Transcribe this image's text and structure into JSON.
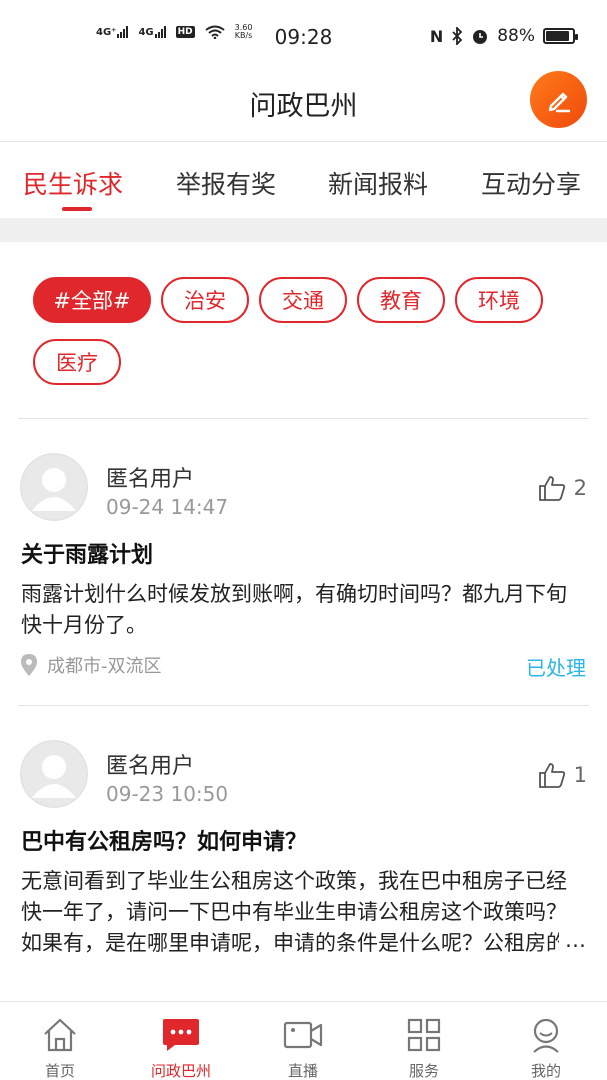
{
  "status_bar": {
    "net1": "4G⁺",
    "net2": "4G",
    "hd": "HD",
    "speed_value": "3.60",
    "speed_unit": "KB/s",
    "time": "09:28",
    "battery": "88%",
    "battery_level": 0.88
  },
  "header": {
    "title": "问政巴州",
    "compose_icon": "pencil-icon"
  },
  "tabs": [
    {
      "label": "民生诉求",
      "active": true
    },
    {
      "label": "举报有奖",
      "active": false
    },
    {
      "label": "新闻报料",
      "active": false
    },
    {
      "label": "互动分享",
      "active": false
    }
  ],
  "tags": [
    {
      "label": "#全部#",
      "active": true
    },
    {
      "label": "治安",
      "active": false
    },
    {
      "label": "交通",
      "active": false
    },
    {
      "label": "教育",
      "active": false
    },
    {
      "label": "环境",
      "active": false
    },
    {
      "label": "医疗",
      "active": false
    }
  ],
  "posts": [
    {
      "user": "匿名用户",
      "time": "09-24 14:47",
      "likes": "2",
      "title": "关于雨露计划",
      "body": "雨露计划什么时候发放到账啊，有确切时间吗？都九月下旬快十月份了。",
      "location": "成都市-双流区",
      "status": "已处理"
    },
    {
      "user": "匿名用户",
      "time": "09-23 10:50",
      "likes": "1",
      "title": "巴中有公租房吗？如何申请？",
      "body": "无意间看到了毕业生公租房这个政策，我在巴中租房子已经快一年了，请问一下巴中有毕业生申请公租房这个政策吗？如果有，是在哪里申请呢，申请的条件是什么呢？公租房的具体位置在哪里呢？",
      "ellipsis": "…"
    }
  ],
  "bottom_nav": [
    {
      "label": "首页",
      "icon": "home-icon",
      "active": false
    },
    {
      "label": "问政巴州",
      "icon": "chat-icon",
      "active": true
    },
    {
      "label": "直播",
      "icon": "video-icon",
      "active": false
    },
    {
      "label": "服务",
      "icon": "grid-icon",
      "active": false
    },
    {
      "label": "我的",
      "icon": "profile-icon",
      "active": false
    }
  ],
  "colors": {
    "accent": "#e0272c",
    "status_done": "#2ab6e6",
    "compose_orange": "#f4611a"
  }
}
